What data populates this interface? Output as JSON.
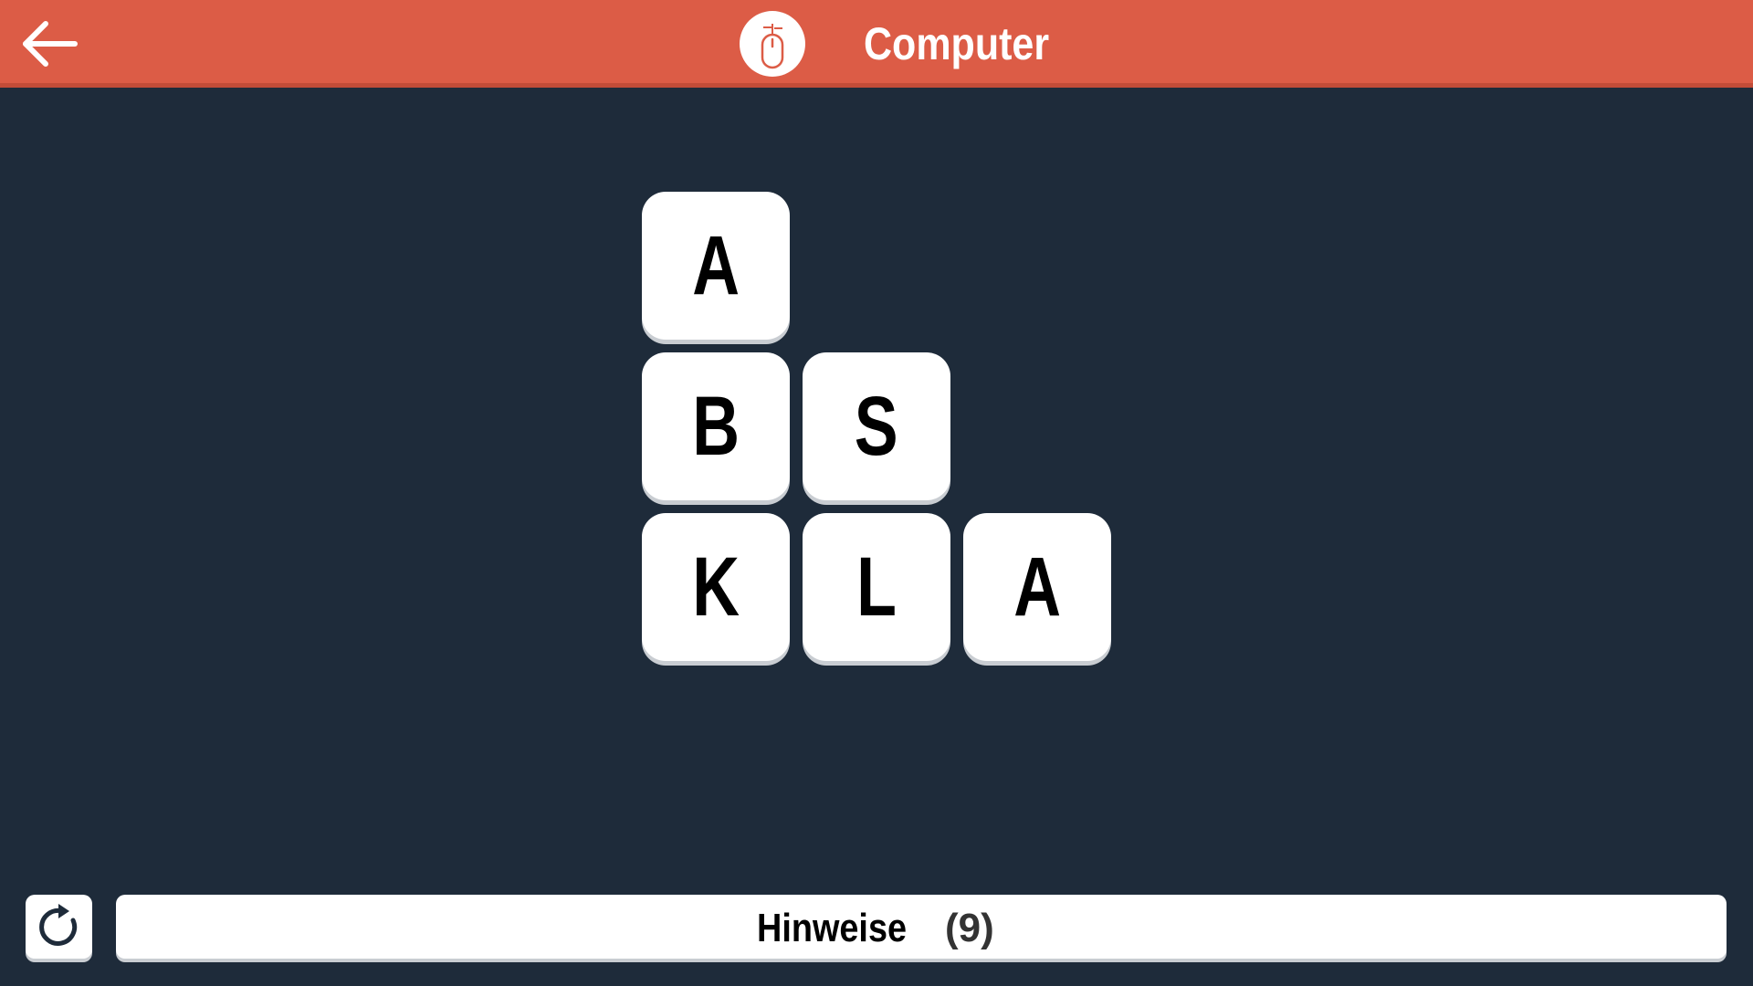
{
  "header": {
    "title": "Computer",
    "back_icon": "arrow-left-icon",
    "category_icon": "computer-mouse-icon",
    "background_color": "#dc5c46"
  },
  "board": {
    "rows": [
      [
        "A"
      ],
      [
        "B",
        "S"
      ],
      [
        "K",
        "L",
        "A"
      ]
    ],
    "tile_color": "#ffffff",
    "letter_color": "#000000"
  },
  "footer": {
    "reset_icon": "reset-icon",
    "hints_label": "Hinweise",
    "hints_count": "(9)"
  },
  "colors": {
    "background": "#1e2b3a",
    "accent": "#dc5c46"
  }
}
